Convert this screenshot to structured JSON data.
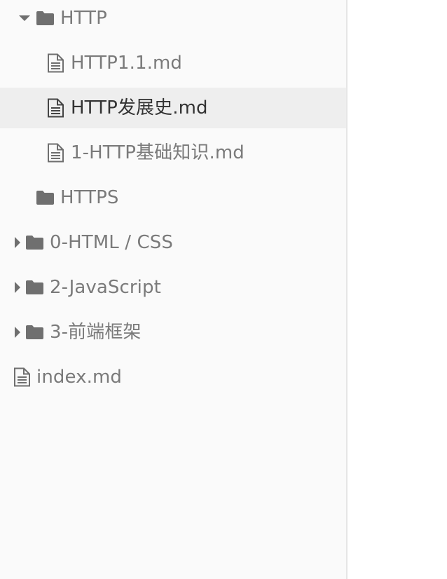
{
  "sidebar": {
    "items": [
      {
        "label": "HTTP",
        "type": "folder",
        "state": "expanded",
        "icon": "folder-icon",
        "chevron": "chevron-down-icon"
      },
      {
        "label": "HTTP1.1.md",
        "type": "file",
        "icon": "file-icon"
      },
      {
        "label": "HTTP发展史.md",
        "type": "file",
        "icon": "file-icon",
        "active": true
      },
      {
        "label": "1-HTTP基础知识.md",
        "type": "file",
        "icon": "file-icon"
      },
      {
        "label": "HTTPS",
        "type": "folder",
        "icon": "folder-icon"
      },
      {
        "label": "0-HTML / CSS",
        "type": "folder",
        "state": "collapsed",
        "icon": "folder-icon",
        "chevron": "chevron-right-icon"
      },
      {
        "label": "2-JavaScript",
        "type": "folder",
        "state": "collapsed",
        "icon": "folder-icon",
        "chevron": "chevron-right-icon"
      },
      {
        "label": "3-前端框架",
        "type": "folder",
        "state": "collapsed",
        "icon": "folder-icon",
        "chevron": "chevron-right-icon"
      },
      {
        "label": "index.md",
        "type": "file",
        "icon": "file-icon"
      }
    ]
  },
  "colors": {
    "sidebar_bg": "#fafafa",
    "active_row_bg": "#eeeeee",
    "text": "#7a7a7a",
    "active_text": "#333333",
    "icon": "#6f6f6f",
    "divider": "#e6e6e6"
  }
}
